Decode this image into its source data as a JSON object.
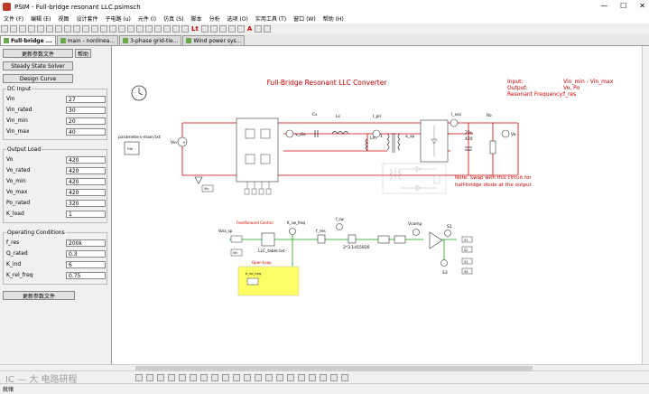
{
  "window": {
    "title": "PSIM - Full-bridge resonant LLC.psimsch",
    "minimize": "—",
    "maximize": "☐",
    "close": "✕"
  },
  "menu": [
    "文件 (F)",
    "编辑 (E)",
    "视图",
    "设计套件",
    "子电路 (u)",
    "元件 (l)",
    "仿真 (S)",
    "脚本",
    "分析",
    "选项 (O)",
    "实用工具 (T)",
    "窗口 (W)",
    "帮助 (H)"
  ],
  "toolbar": {
    "lt_label": "Lt",
    "a_label": "A"
  },
  "tabs": [
    {
      "label": "Full-bridge ...",
      "active": true
    },
    {
      "label": "main - nonlinea...",
      "active": false
    },
    {
      "label": "3-phase grid-tie...",
      "active": false
    },
    {
      "label": "Wind power sys...",
      "active": false
    }
  ],
  "panel": {
    "update_button": "更新参数文件",
    "help_button": "帮助",
    "steady_button": "Steady State Solver",
    "design_button": "Design Curve",
    "bottom_button": "更新参数文件",
    "groups": [
      {
        "title": "DC Input",
        "rows": [
          {
            "label": "Vin",
            "value": "27"
          },
          {
            "label": "Vin_rated",
            "value": "30"
          },
          {
            "label": "Vin_min",
            "value": "20"
          },
          {
            "label": "Vin_max",
            "value": "40"
          }
        ]
      },
      {
        "title": "Output Load",
        "rows": [
          {
            "label": "Vo",
            "value": "420"
          },
          {
            "label": "Vo_rated",
            "value": "420"
          },
          {
            "label": "Vo_min",
            "value": "420"
          },
          {
            "label": "Vo_max",
            "value": "420"
          },
          {
            "label": "Po_rated",
            "value": "320"
          },
          {
            "label": "K_load",
            "value": "1"
          }
        ]
      },
      {
        "title": "Operating Conditions",
        "rows": [
          {
            "label": "f_res",
            "value": "200k"
          },
          {
            "label": "Q_rated",
            "value": "0.3"
          },
          {
            "label": "K_ind",
            "value": "6"
          },
          {
            "label": "K_rel_freq",
            "value": "0.75"
          }
        ]
      }
    ]
  },
  "schematic": {
    "title": "Full-Bridge Resonant LLC Converter",
    "info_labels": [
      "Input:",
      "Output:",
      "Resonant Frequency:"
    ],
    "info_values": [
      "Vin_min - Vin_max",
      "Vo, Po",
      "f_res"
    ],
    "note_line1": "Note: Swap with this circuit for",
    "note_line2": "half-bridge diode at the output",
    "param_file": "parameters-main.txt",
    "param_file_short": "File",
    "labels": {
      "vin": "Vin",
      "vdiv": "v_div",
      "cs": "Cs",
      "ls": "Ls",
      "ipri": "I_pri",
      "lm": "Lm",
      "ratio": "1",
      "asp": "a_sp",
      "isec": "I_sec",
      "ro": "Ro",
      "co": "20u",
      "co2": "420",
      "vo": "Vo",
      "vin_bottom": "Vin",
      "feedforward": "Feedforward Control",
      "kswfreq": "K_sw_freq",
      "vin_sp": "Vo/a_sp",
      "vin_box": "Vin",
      "llc": "LLC_table.txt",
      "fres": "f_res",
      "fsw": "f_sw",
      "pi": "2*3.1415926",
      "vcomp": "Vcomp",
      "s1": "S1",
      "s3": "S3",
      "ktri": "K_tri",
      "openloop": "Open-Loop",
      "krelfreq": "K_rel_freq",
      "out1": "S1",
      "out2": "S2",
      "out3": "S3",
      "out4": "S4"
    }
  },
  "status": {
    "text": "就绪"
  },
  "watermark": "IC — 大  电路研程"
}
